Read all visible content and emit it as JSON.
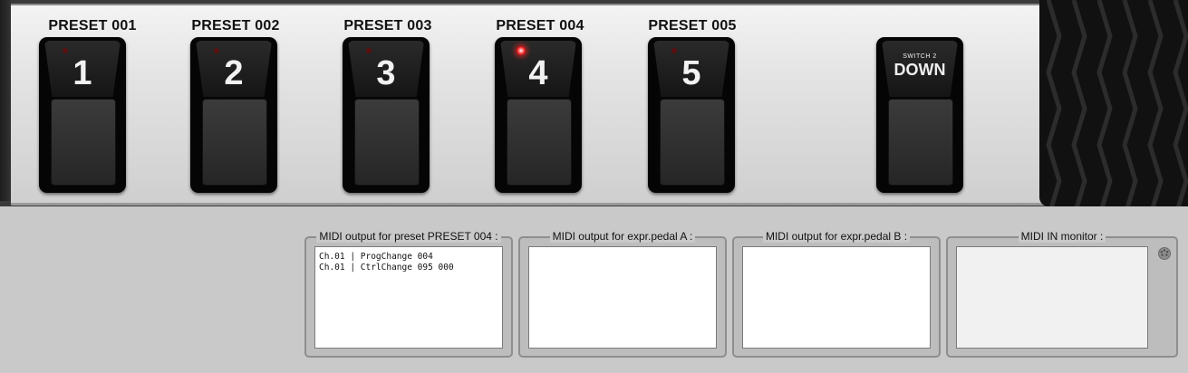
{
  "presets": [
    {
      "label": "PRESET 001",
      "number": "1",
      "led_on": false
    },
    {
      "label": "PRESET 002",
      "number": "2",
      "led_on": false
    },
    {
      "label": "PRESET 003",
      "number": "3",
      "led_on": false
    },
    {
      "label": "PRESET 004",
      "number": "4",
      "led_on": true
    },
    {
      "label": "PRESET 005",
      "number": "5",
      "led_on": false
    }
  ],
  "switch2": {
    "small_label": "SWITCH 2",
    "big_label": "DOWN"
  },
  "monitors": {
    "preset_output": {
      "title": "MIDI output for preset PRESET 004 :",
      "lines": [
        "Ch.01 | ProgChange 004",
        "Ch.01 | CtrlChange 095 000"
      ]
    },
    "expr_a": {
      "title": "MIDI output for expr.pedal A :"
    },
    "expr_b": {
      "title": "MIDI output for expr.pedal B :"
    },
    "midi_in": {
      "title": "MIDI IN monitor :",
      "icon": "midi-connector-icon"
    }
  },
  "colors": {
    "led_on": "#e00000",
    "led_off": "#5a1010",
    "background": "#c9c9c9"
  }
}
